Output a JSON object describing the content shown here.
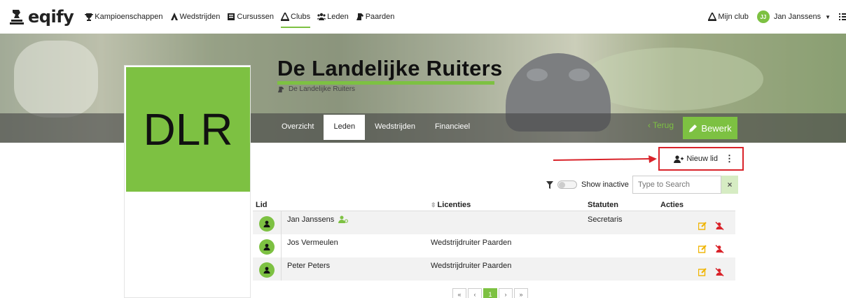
{
  "brand": {
    "name": "eqify"
  },
  "nav": {
    "items": [
      {
        "label": "Kampioenschappen",
        "icon": "trophy-icon"
      },
      {
        "label": "Wedstrijden",
        "icon": "rider-icon"
      },
      {
        "label": "Cursussen",
        "icon": "book-icon"
      },
      {
        "label": "Clubs",
        "icon": "club-icon",
        "active": true
      },
      {
        "label": "Leden",
        "icon": "users-icon"
      },
      {
        "label": "Paarden",
        "icon": "horse-icon"
      }
    ],
    "my_club": "Mijn club",
    "user_initials": "JJ",
    "user_name": "Jan Janssens"
  },
  "club": {
    "title": "De Landelijke Ruiters",
    "breadcrumb": "De Landelijke Ruiters",
    "logo_text": "DLR"
  },
  "tabs": [
    {
      "label": "Overzicht",
      "active": false
    },
    {
      "label": "Leden",
      "active": true
    },
    {
      "label": "Wedstrijden",
      "active": false
    },
    {
      "label": "Financieel",
      "active": false
    }
  ],
  "actions": {
    "back": "Terug",
    "edit": "Bewerk",
    "new_member": "Nieuw lid"
  },
  "filters": {
    "show_inactive": "Show inactive",
    "search_placeholder": "Type to Search",
    "clear": "×"
  },
  "table": {
    "headers": {
      "member": "Lid",
      "licenses": "Licenties",
      "statutes": "Statuten",
      "actions": "Acties"
    },
    "rows": [
      {
        "name": "Jan Janssens",
        "license": "",
        "statute": "Secretaris",
        "admin_badge": true
      },
      {
        "name": "Jos Vermeulen",
        "license": "Wedstrijdruiter Paarden",
        "statute": ""
      },
      {
        "name": "Peter Peters",
        "license": "Wedstrijdruiter Paarden",
        "statute": ""
      }
    ]
  },
  "pagination": {
    "current": "1"
  },
  "colors": {
    "accent": "#7dc142",
    "highlight": "#d9232a",
    "delete": "#d9232a",
    "edit": "#f0b400"
  }
}
